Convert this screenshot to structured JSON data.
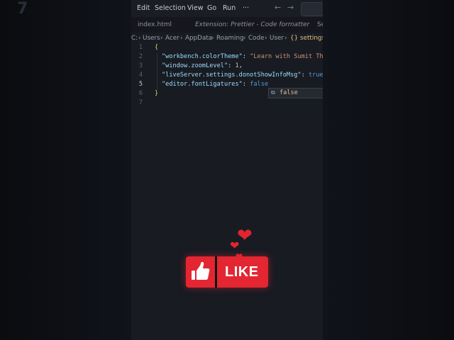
{
  "background": {
    "ghost_number": "7"
  },
  "menubar": {
    "items": [
      "Edit",
      "Selection",
      "View",
      "Go",
      "Run",
      "···"
    ],
    "back_icon": "arrow-left-icon",
    "forward_icon": "arrow-right-icon"
  },
  "tabs": [
    {
      "label": "index.html"
    },
    {
      "label": "Extension: Prettier - Code formatter"
    },
    {
      "label": "Se"
    }
  ],
  "breadcrumb": [
    "C:",
    "Users",
    "Acer",
    "AppData",
    "Roaming",
    "Code",
    "User",
    "{} settings."
  ],
  "code": {
    "line_numbers": [
      "1",
      "2",
      "3",
      "4",
      "5",
      "6",
      "7"
    ],
    "active_line": "5",
    "lines": [
      {
        "open": "{"
      },
      {
        "key": "\"workbench.colorTheme\"",
        "value": "\"Learn with Sumit The"
      },
      {
        "key": "\"window.zoomLevel\"",
        "value": "1"
      },
      {
        "key": "\"liveServer.settings.donotShowInfoMsg\"",
        "value": "true"
      },
      {
        "key": "\"editor.fontLigatures\"",
        "value": "false"
      },
      {
        "close": "}"
      }
    ]
  },
  "suggestion": {
    "label": "false",
    "icon": "value-icon"
  },
  "overlay": {
    "like_label": "LIKE",
    "thumb_icon": "thumbs-up-icon",
    "heart_icon": "heart-icon"
  },
  "colors": {
    "like_red": "#e32631",
    "editor_bg": "#181b22"
  }
}
